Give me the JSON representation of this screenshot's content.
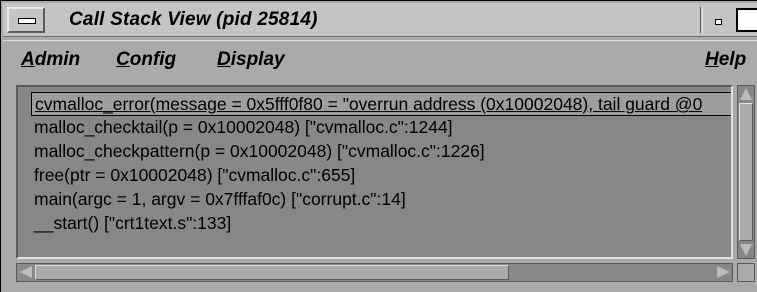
{
  "window": {
    "title": "Call Stack View (pid 25814)"
  },
  "menubar": {
    "admin": {
      "mnemonic": "A",
      "rest": "dmin"
    },
    "config": {
      "mnemonic": "C",
      "rest": "onfig"
    },
    "display": {
      "mnemonic": "D",
      "rest": "isplay"
    },
    "help": {
      "mnemonic": "H",
      "rest": "elp"
    }
  },
  "stack": {
    "selected": "cvmalloc_error(message = 0x5fff0f80 = \"overrun address (0x10002048), tail guard @0",
    "frames": [
      "malloc_checktail(p = 0x10002048) [\"cvmalloc.c\":1244]",
      "malloc_checkpattern(p = 0x10002048) [\"cvmalloc.c\":1226]",
      "free(ptr = 0x10002048) [\"cvmalloc.c\":655]",
      "main(argc = 1, argv = 0x7fffaf0c) [\"corrupt.c\":14]",
      "__start() [\"crt1text.s\":133]"
    ]
  },
  "icons": {
    "window_menu": "window-menu-icon",
    "iconify": "minimize-icon",
    "maximize": "maximize-icon",
    "scroll_up": "arrow-up-icon",
    "scroll_down": "arrow-down-icon",
    "scroll_left": "arrow-left-icon",
    "scroll_right": "arrow-right-icon"
  },
  "colors": {
    "window_bg": "#aaaaaa",
    "content_bg": "#878787",
    "selection_bg": "#9e9e9e"
  }
}
